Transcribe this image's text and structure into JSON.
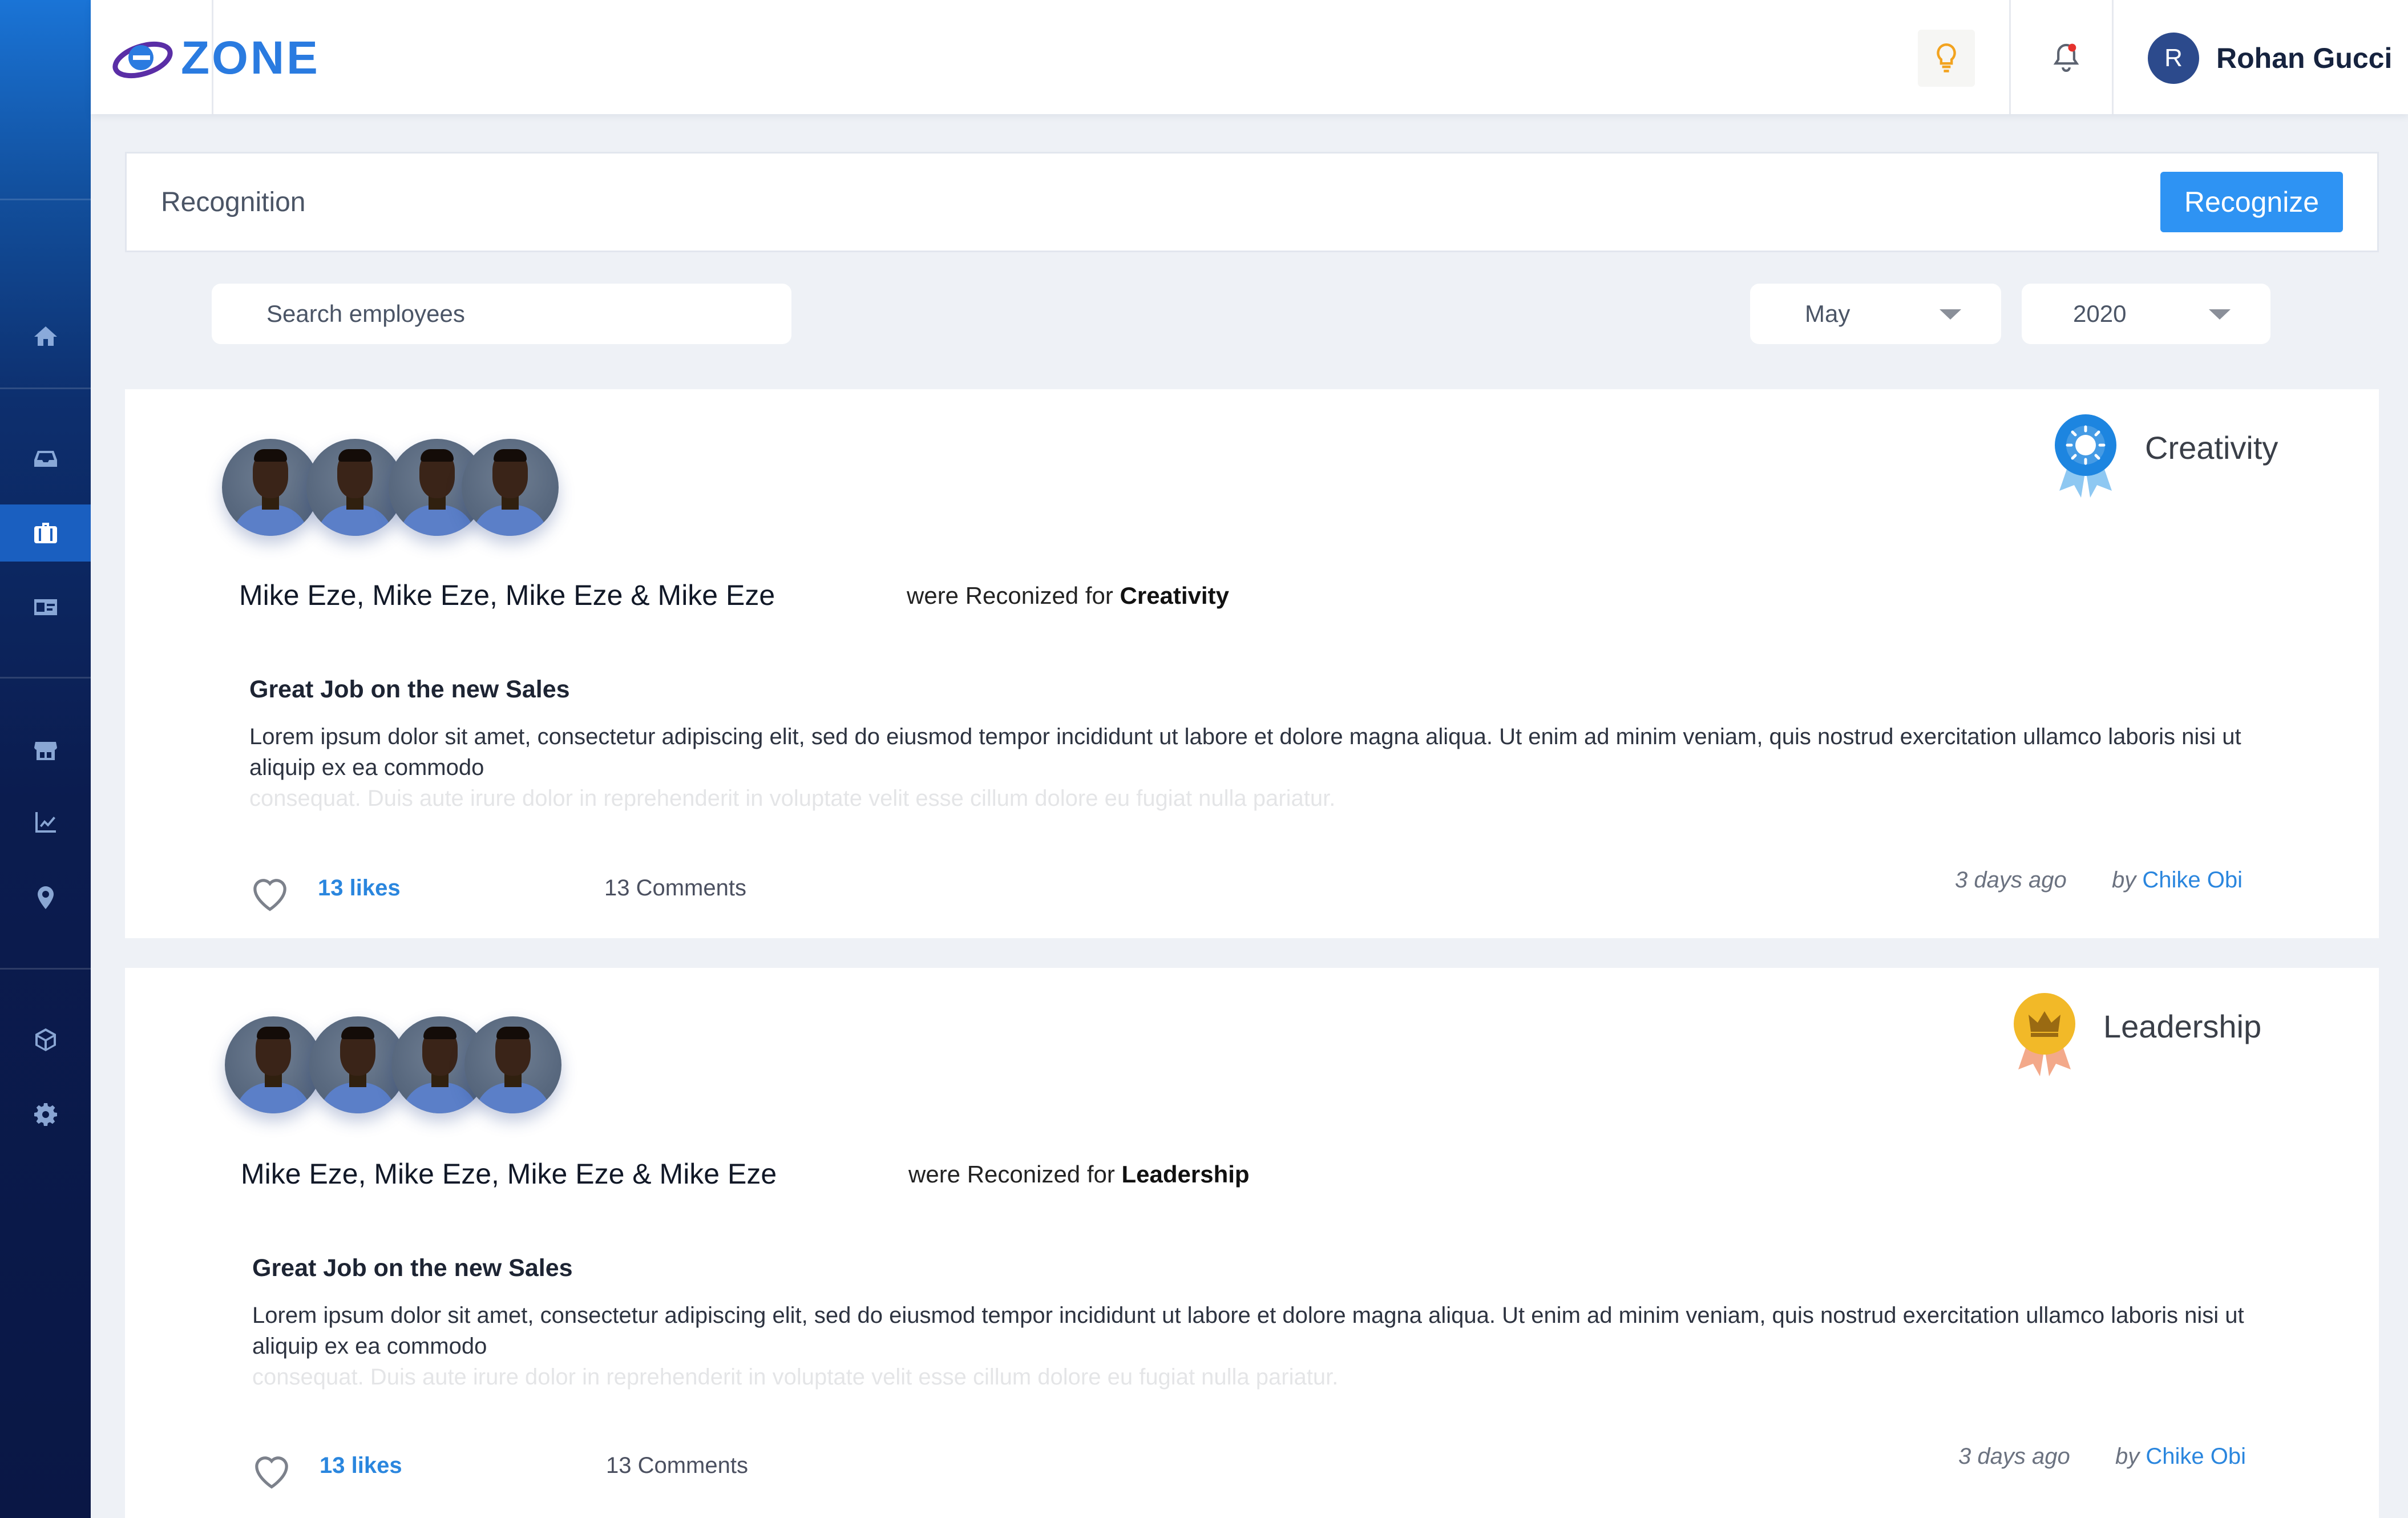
{
  "app": {
    "brand": "ZONE"
  },
  "colors": {
    "accent": "#2e93f3",
    "sidebar": "#0b1c4f",
    "link": "#2a86de",
    "creativity_badge": "#1d85e0",
    "leadership_badge": "#f2b928"
  },
  "sidebar": {
    "items": [
      {
        "icon": "home-icon"
      },
      {
        "icon": "inbox-icon"
      },
      {
        "icon": "briefcase-icon",
        "active": true
      },
      {
        "icon": "id-card-icon"
      },
      {
        "icon": "store-icon"
      },
      {
        "icon": "chart-icon"
      },
      {
        "icon": "location-pin-icon"
      },
      {
        "icon": "cube-icon"
      },
      {
        "icon": "gear-icon"
      }
    ]
  },
  "topbar": {
    "user_initial": "R",
    "user_name": "Rohan Gucci",
    "icons": [
      "lightbulb-icon",
      "bell-icon"
    ]
  },
  "header": {
    "title": "Recognition",
    "recognize_label": "Recognize"
  },
  "filters": {
    "search_placeholder": "Search employees",
    "month": "May",
    "year": "2020"
  },
  "posts": [
    {
      "names": "Mike Eze, Mike Eze, Mike Eze & Mike Eze",
      "recognized_prefix": "were Reconized for",
      "category": "Creativity",
      "badge_label": "Creativity",
      "title": "Great Job on the new Sales",
      "body": "Lorem ipsum dolor sit amet, consectetur adipiscing elit, sed do eiusmod tempor incididunt ut labore et dolore magna aliqua. Ut enim ad minim veniam, quis nostrud exercitation ullamco laboris nisi ut aliquip ex ea commodo",
      "body_faded": "consequat. Duis aute irure dolor in reprehenderit in voluptate velit esse cillum dolore eu fugiat nulla pariatur.",
      "likes": "13 likes",
      "comments": "13 Comments",
      "time": "3 days ago",
      "by_prefix": "by",
      "author": "Chike Obi"
    },
    {
      "names": "Mike Eze, Mike Eze, Mike Eze & Mike Eze",
      "recognized_prefix": "were Reconized for",
      "category": "Leadership",
      "badge_label": "Leadership",
      "title": "Great Job on the new Sales",
      "body": "Lorem ipsum dolor sit amet, consectetur adipiscing elit, sed do eiusmod tempor incididunt ut labore et dolore magna aliqua. Ut enim ad minim veniam, quis nostrud exercitation ullamco laboris nisi ut aliquip ex ea commodo",
      "body_faded": "consequat. Duis aute irure dolor in reprehenderit in voluptate velit esse cillum dolore eu fugiat nulla pariatur.",
      "likes": "13 likes",
      "comments": "13 Comments",
      "time": "3 days ago",
      "by_prefix": "by",
      "author": "Chike Obi"
    }
  ]
}
